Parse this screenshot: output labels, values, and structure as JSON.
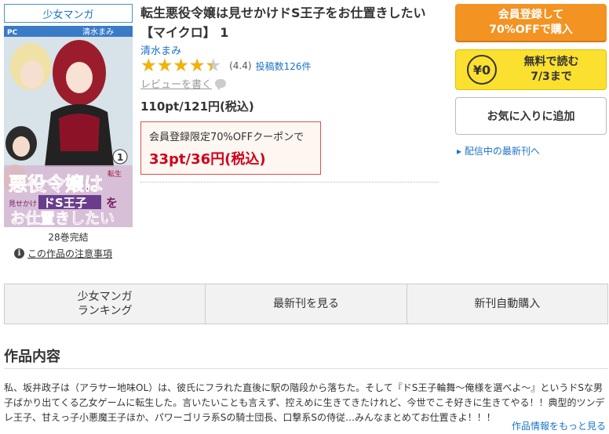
{
  "genre_tag": "少女マンガ",
  "book": {
    "title": "転生悪役令嬢は見せかけドS王子をお仕置きしたい【マイクロ】 1",
    "author": "清水まみ",
    "rating_value": 4.4,
    "rating_max": 5,
    "score_text": "(4.4)",
    "review_count_text": "投稿数126件",
    "write_review": "レビューを書く",
    "price": "110pt/121円(税込)"
  },
  "coupon": {
    "label": "会員登録限定70%OFFクーポンで",
    "price": "33pt/36円(税込)"
  },
  "cover": {
    "label_pc": "PC",
    "author": "清水まみ",
    "volume": "1",
    "title_line1": "悪役令嬢は",
    "title_line2_small": "見せかけ",
    "title_line2": "ドS王子",
    "title_line2_suffix": "を",
    "title_line3": "お仕置きしたい",
    "tensei": "転生"
  },
  "meta": {
    "volumes": "28巻完結",
    "caution": "この作品の注意事項"
  },
  "actions": {
    "register_line1": "会員登録して",
    "register_line2": "70%OFFで購入",
    "free_icon": "¥0",
    "free_line1": "無料で読む",
    "free_line2": "7/3まで",
    "favorite": "お気に入りに追加",
    "latest": "配信中の最新刊へ"
  },
  "tabs": [
    {
      "line1": "少女マンガ",
      "line2": "ランキング"
    },
    {
      "line1": "最新刊を見る",
      "line2": ""
    },
    {
      "line1": "新刊自動購入",
      "line2": ""
    }
  ],
  "synopsis": {
    "heading": "作品内容",
    "text": "私、坂井政子は（アラサー地味OL）は、彼氏にフラれた直後に駅の階段から落ちた。そして『ドS王子輪舞～俺様を選べよ～』というドSな男子ばかり出てくる乙女ゲームに転生した。言いたいことも言えず、控えめに生きてきたけれど、今世でこそ好きに生きてやる！！典型的ツンデレ王子、甘えっ子小悪魔王子ほか、パワーゴリラ系Sの騎士団長、口撃系Sの侍従…みんなまとめてお仕置きよ！！！",
    "more": "作品情報をもっと見る"
  },
  "colors": {
    "accent_blue": "#1a73c8",
    "register_orange": "#f39322",
    "free_yellow": "#fbe030",
    "star": "#f1b10a",
    "coupon_red": "#d0021b"
  }
}
